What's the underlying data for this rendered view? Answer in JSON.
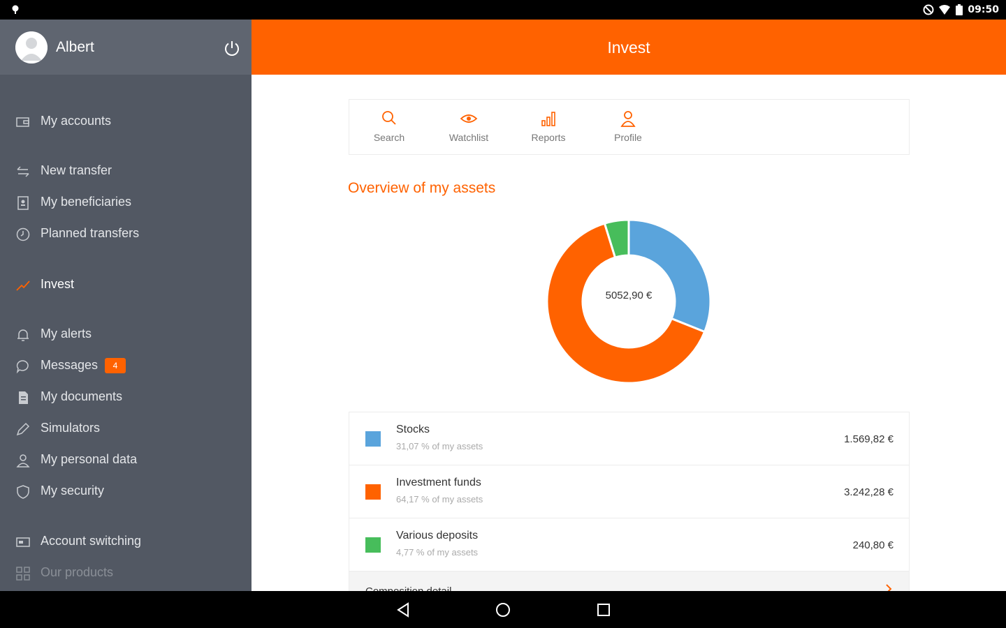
{
  "status_bar": {
    "time": "09:50",
    "icons": [
      "notification-icon",
      "do-not-disturb-icon",
      "wifi-icon",
      "battery-icon"
    ]
  },
  "user": {
    "name": "Albert"
  },
  "sidebar": {
    "items": [
      {
        "label": "My accounts",
        "icon": "wallet-icon"
      },
      {
        "label": "New transfer",
        "icon": "transfer-arrows-icon"
      },
      {
        "label": "My beneficiaries",
        "icon": "contact-book-icon"
      },
      {
        "label": "Planned transfers",
        "icon": "clock-icon"
      },
      {
        "label": "Invest",
        "icon": "trend-icon"
      },
      {
        "label": "My alerts",
        "icon": "bell-icon"
      },
      {
        "label": "Messages",
        "icon": "chat-bubble-icon",
        "badge": "4"
      },
      {
        "label": "My documents",
        "icon": "document-icon"
      },
      {
        "label": "Simulators",
        "icon": "pencil-icon"
      },
      {
        "label": "My personal data",
        "icon": "person-icon"
      },
      {
        "label": "My security",
        "icon": "shield-icon"
      },
      {
        "label": "Account switching",
        "icon": "card-switch-icon"
      },
      {
        "label": "Our products",
        "icon": "grid-icon"
      }
    ]
  },
  "header": {
    "title": "Invest"
  },
  "tabs": [
    {
      "label": "Search",
      "icon": "search-icon"
    },
    {
      "label": "Watchlist",
      "icon": "eye-icon"
    },
    {
      "label": "Reports",
      "icon": "bar-chart-icon"
    },
    {
      "label": "Profile",
      "icon": "profile-icon"
    }
  ],
  "overview": {
    "title": "Overview of my assets",
    "total": "5052,90 €"
  },
  "colors": {
    "brand_orange": "#ff6200",
    "sidebar": "#525863",
    "stocks": "#5aa4dc",
    "funds": "#ff6200",
    "deposits": "#47bd5b"
  },
  "chart_data": {
    "type": "pie",
    "categories": [
      "Stocks",
      "Investment funds",
      "Various deposits"
    ],
    "values": [
      31.07,
      64.17,
      4.77
    ],
    "colors": [
      "#5aa4dc",
      "#ff6200",
      "#47bd5b"
    ]
  },
  "assets": [
    {
      "name": "Stocks",
      "pct_text": "31,07 % of my assets",
      "amount": "1.569,82 €"
    },
    {
      "name": "Investment funds",
      "pct_text": "64,17 % of my assets",
      "amount": "3.242,28 €"
    },
    {
      "name": "Various deposits",
      "pct_text": "4,77 % of my assets",
      "amount": "240,80 €"
    }
  ],
  "more_row": {
    "label": "Composition detail"
  }
}
